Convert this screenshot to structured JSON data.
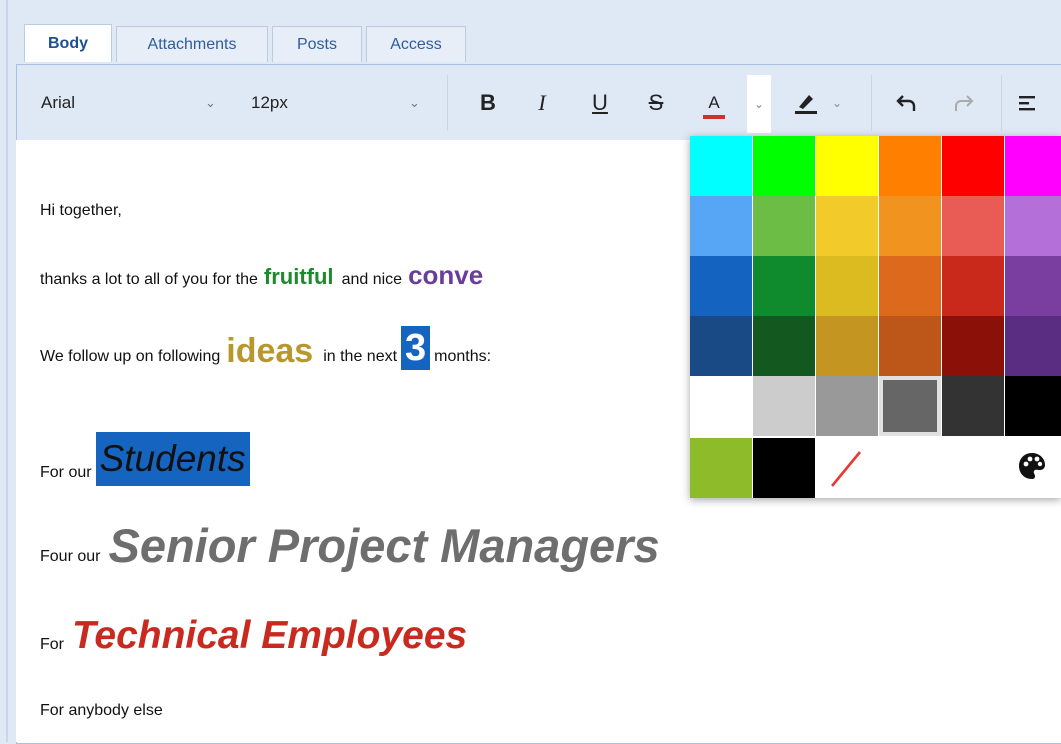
{
  "tabs": [
    {
      "label": "Body",
      "active": true
    },
    {
      "label": "Attachments",
      "active": false
    },
    {
      "label": "Posts",
      "active": false
    },
    {
      "label": "Access",
      "active": false
    }
  ],
  "toolbar": {
    "font_family": "Arial",
    "font_size": "12px",
    "bold": "B",
    "italic": "I",
    "underline": "U",
    "strike": "S",
    "font_color": "A",
    "font_color_accent": "#d0312d"
  },
  "content": {
    "greeting": "Hi together,",
    "line2_prefix": "thanks a lot to all of you for the",
    "line2_fruitful": "fruitful",
    "line2_middle": "and nice",
    "line2_conve": "conve",
    "line3_prefix": "We follow up on following",
    "line3_ideas": "ideas",
    "line3_middle": "in the next",
    "line3_number": "3",
    "line3_suffix": "months:",
    "line4_prefix": "For our",
    "line4_highlight": "Students",
    "line5_prefix": "Four our",
    "line5_big": "Senior Project Managers",
    "line6_prefix": "For",
    "line6_big": "Technical Employees",
    "line7": "For anybody else"
  },
  "colors": {
    "fruitful": "#1e8a2e",
    "conve": "#6a3d9a",
    "ideas": "#b8972c",
    "number_bg": "#1565c0",
    "students_bg": "#1565c0",
    "senior": "#6e6e6e",
    "technical": "#c92a1f"
  },
  "color_picker": {
    "rows": [
      [
        "#00ffff",
        "#00ff00",
        "#ffff00",
        "#ff8000",
        "#ff0000",
        "#ff00ff"
      ],
      [
        "#56a6f5",
        "#6cbd45",
        "#f2cb2b",
        "#f0931f",
        "#e95c55",
        "#b56fd8"
      ],
      [
        "#1463c0",
        "#0f8a2c",
        "#dcbb21",
        "#dd6a1c",
        "#c8291a",
        "#7a3ea1"
      ],
      [
        "#1a4a85",
        "#13591f",
        "#c49520",
        "#bd5719",
        "#8b1108",
        "#5a2d82"
      ],
      [
        "#ffffff",
        "#cccccc",
        "#999999",
        "#666666",
        "#333333",
        "#000000"
      ]
    ],
    "extra": [
      "#8dbb2a",
      "#000000"
    ],
    "selected": "#666666",
    "remove_color_icon": "no-color-icon",
    "palette_icon": "palette-icon"
  }
}
